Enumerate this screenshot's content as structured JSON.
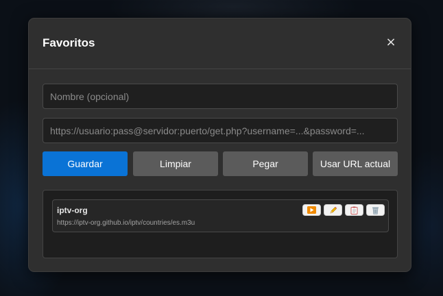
{
  "dialog": {
    "title": "Favoritos",
    "close_label": "×"
  },
  "form": {
    "name_placeholder": "Nombre (opcional)",
    "name_value": "",
    "url_placeholder": "https://usuario:pass@servidor:puerto/get.php?username=...&password=...",
    "url_value": ""
  },
  "buttons": {
    "save": "Guardar",
    "clear": "Limpiar",
    "paste": "Pegar",
    "use_current": "Usar URL actual"
  },
  "favorites": [
    {
      "name": "iptv-org",
      "url": "https://iptv-org.github.io/iptv/countries/es.m3u",
      "actions": [
        "play-icon",
        "edit-icon",
        "copy-icon",
        "delete-icon"
      ]
    }
  ],
  "colors": {
    "primary": "#0a73d6",
    "secondary": "#5b5b5b",
    "dialog_bg": "#2f2f2f",
    "play_accent": "#f08a00"
  }
}
